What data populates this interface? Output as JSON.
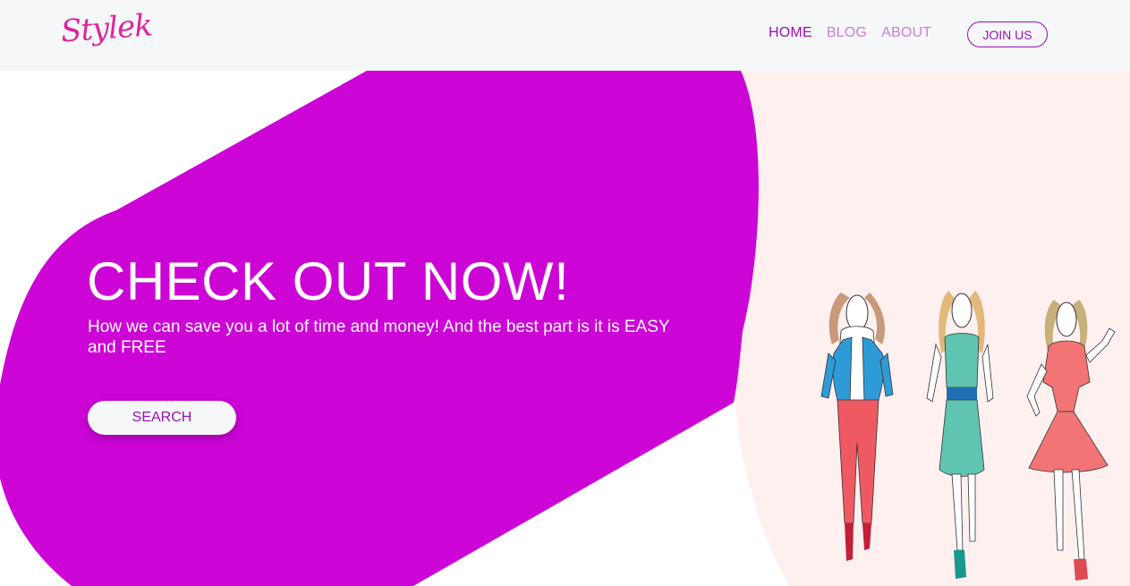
{
  "brand": {
    "logo_text": "Stylek",
    "logo_color": "#e0239d"
  },
  "nav": {
    "links": [
      {
        "label": "HOME",
        "active": true
      },
      {
        "label": "BLOG",
        "active": false
      },
      {
        "label": "ABOUT",
        "active": false
      }
    ],
    "join_label": "JOIN US"
  },
  "hero": {
    "title": "CHECK OUT NOW!",
    "subtitle": "How we can save you a lot of time and money! And the best part is it is EASY and FREE",
    "search_label": "SEARCH"
  },
  "theme": {
    "accent": "#cc05d6",
    "nav_active": "#9a10b8",
    "nav_inactive": "#c97fd9",
    "right_panel": "#fff0f0"
  },
  "illustration": {
    "icon": "fashion-models-illustration",
    "figures": [
      "model-blue-jacket-figure",
      "model-teal-dress-figure",
      "model-coral-dress-figure"
    ]
  }
}
